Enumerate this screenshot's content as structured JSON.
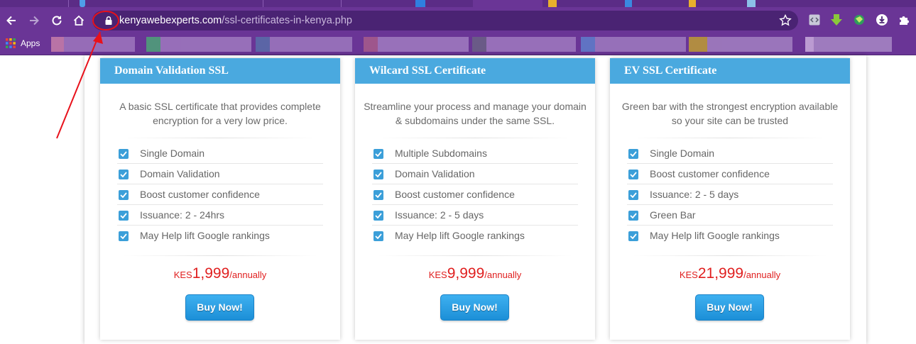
{
  "browser": {
    "url_domain": "kenyawebexperts.com",
    "url_path": "/ssl-certificates-in-kenya.php",
    "apps_label": "Apps"
  },
  "colors": {
    "chrome": "#6a3596",
    "omnibox": "#4a2373",
    "card_header": "#4aa9df",
    "price": "#e01f1f",
    "button": "#2a9be0",
    "annotation": "#e8111b"
  },
  "cards": [
    {
      "title": "Domain Validation SSL",
      "description": "A basic SSL certificate that provides complete encryption for a very low price.",
      "features": [
        "Single Domain",
        "Domain Validation",
        "Boost customer confidence",
        "Issuance: 2 - 24hrs",
        "May Help lift Google rankings"
      ],
      "currency": "KES",
      "amount": "1,999",
      "period": "/annually",
      "button": "Buy Now!"
    },
    {
      "title": "Wilcard SSL Certificate",
      "description": "Streamline your process and manage your domain & subdomains under the same SSL.",
      "features": [
        "Multiple Subdomains",
        "Domain Validation",
        "Boost customer confidence",
        "Issuance: 2 - 5 days",
        "May Help lift Google rankings"
      ],
      "currency": "KES",
      "amount": "9,999",
      "period": "/annually",
      "button": "Buy Now!"
    },
    {
      "title": "EV SSL Certificate",
      "description": "Green bar with the strongest encryption available so your site can be trusted",
      "features": [
        "Single Domain",
        "Boost customer confidence",
        "Issuance: 2 - 5 days",
        "Green Bar",
        "May Help lift Google rankings"
      ],
      "currency": "KES",
      "amount": "21,999",
      "period": "/annually",
      "button": "Buy Now!"
    }
  ]
}
